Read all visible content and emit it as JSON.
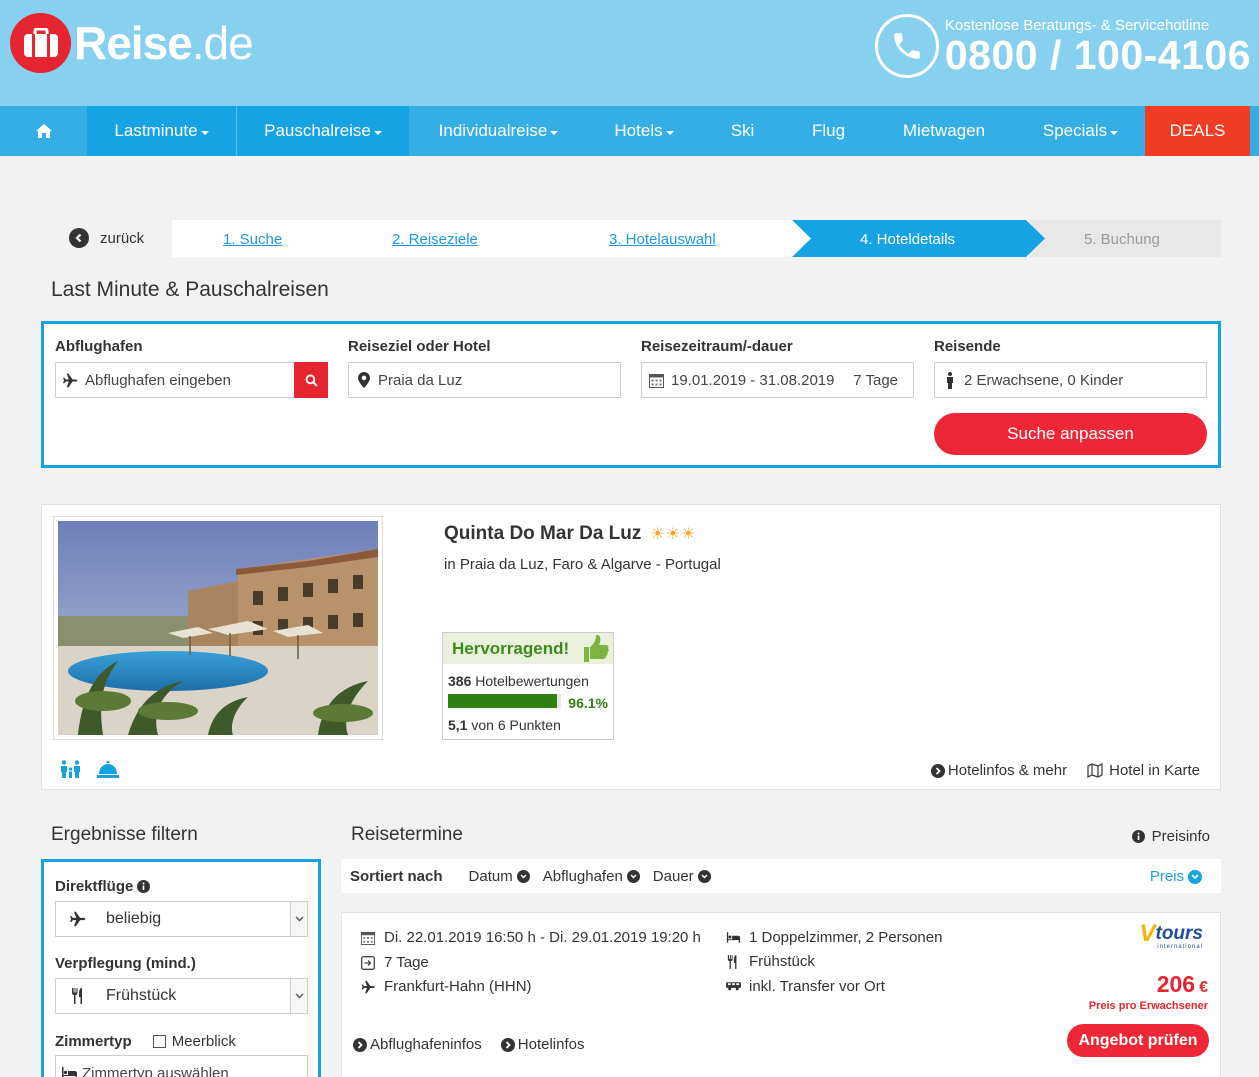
{
  "header": {
    "logo_bold": "Reise",
    "logo_light": ".de",
    "hotline_label": "Kostenlose Beratungs- & Servicehotline",
    "hotline_number": "0800 / 100-4106"
  },
  "nav": {
    "items": [
      {
        "label": "Lastminute"
      },
      {
        "label": "Pauschalreise"
      },
      {
        "label": "Individualreise"
      },
      {
        "label": "Hotels"
      },
      {
        "label": "Ski"
      },
      {
        "label": "Flug"
      },
      {
        "label": "Mietwagen"
      },
      {
        "label": "Specials"
      },
      {
        "label": "DEALS"
      }
    ]
  },
  "steps": {
    "back": "zurück",
    "items": [
      "1. Suche",
      "2. Reiseziele",
      "3. Hotelauswahl",
      "4. Hoteldetails",
      "5. Buchung"
    ],
    "current": 4
  },
  "page_title": "Last Minute & Pauschalreisen",
  "search": {
    "departure_label": "Abflughafen",
    "departure_placeholder": "Abflughafen eingeben",
    "destination_label": "Reiseziel oder Hotel",
    "destination_value": "Praia da Luz",
    "period_label": "Reisezeitraum/-dauer",
    "period_value": "19.01.2019 - 31.08.2019",
    "duration_value": "7 Tage",
    "travellers_label": "Reisende",
    "travellers_value": "2 Erwachsene, 0 Kinder",
    "button": "Suche anpassen"
  },
  "hotel": {
    "name": "Quinta Do Mar Da Luz",
    "stars": 3,
    "stars_text": "☀☀☀",
    "location": "in Praia da Luz, Faro & Algarve - Portugal",
    "rating_title": "Hervorragend!",
    "reviews_count": "386",
    "reviews_label": "Hotelbewertungen",
    "recommend_percent": 96.1,
    "recommend_text": "96.1%",
    "points": "5,1",
    "points_label": "von 6 Punkten",
    "links": {
      "info": "Hotelinfos & mehr",
      "map": "Hotel in Karte"
    }
  },
  "filter": {
    "title": "Ergebnisse filtern",
    "direct_label": "Direktflüge",
    "direct_value": "beliebig",
    "board_label": "Verpflegung (mind.)",
    "board_value": "Frühstück",
    "room_label": "Zimmertyp",
    "seaview_label": "Meerblick",
    "room_placeholder": "Zimmertyp auswählen"
  },
  "results": {
    "title": "Reisetermine",
    "preisinfo": "Preisinfo",
    "sort_label": "Sortiert nach",
    "sort_options": [
      "Datum",
      "Abflughafen",
      "Dauer"
    ],
    "sort_active": "Preis",
    "offer": {
      "dates": "Di. 22.01.2019 16:50 h - Di. 29.01.2019 19:20 h",
      "duration": "7 Tage",
      "airport": "Frankfurt-Hahn (HHN)",
      "room": "1 Doppelzimmer, 2 Personen",
      "board": "Frühstück",
      "transfer": "inkl. Transfer vor Ort",
      "operator_v": "V",
      "operator_rest": "tours",
      "operator_sub": "international",
      "price": "206",
      "currency": "€",
      "price_note": "Preis pro Erwachsener",
      "button": "Angebot prüfen",
      "link_airport": "Abflughafeninfos",
      "link_hotel": "Hotelinfos"
    }
  },
  "colors": {
    "header_bg": "#87d0ef",
    "nav_bg": "#35aee6",
    "accent_blue": "#16a3e4",
    "brand_red": "#e5252f",
    "deals_bg": "#f13c24",
    "rating_green": "#2f8111"
  }
}
